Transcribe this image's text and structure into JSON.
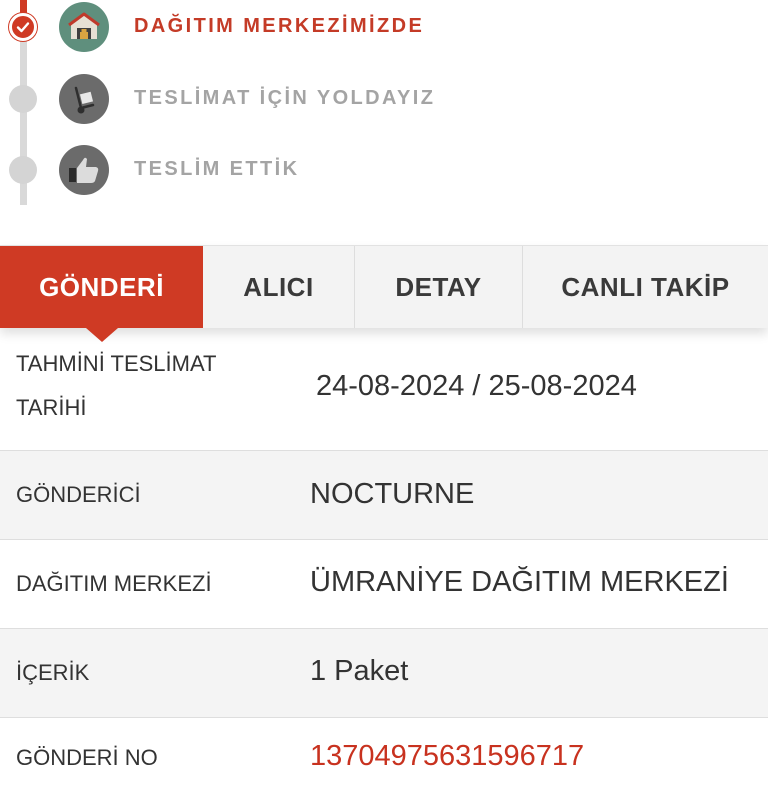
{
  "timeline": {
    "steps": [
      {
        "label": "DAĞITIM MERKEZİMİZDE",
        "status": "done",
        "icon": "warehouse-icon"
      },
      {
        "label": "TESLİMAT İÇİN YOLDAYIZ",
        "status": "pending",
        "icon": "hand-truck-icon"
      },
      {
        "label": "TESLİM ETTİK",
        "status": "pending",
        "icon": "thumbs-up-icon"
      }
    ]
  },
  "tabs": [
    {
      "label": "GÖNDERİ",
      "active": true
    },
    {
      "label": "ALICI",
      "active": false
    },
    {
      "label": "DETAY",
      "active": false
    },
    {
      "label": "CANLI TAKİP",
      "active": false
    }
  ],
  "details": {
    "estimated_delivery": {
      "label_line1": "TAHMİNİ TESLİMAT",
      "label_line2": "TARİHİ",
      "value": "24-08-2024 / 25-08-2024"
    },
    "sender": {
      "label": "GÖNDERİCİ",
      "value": "NOCTURNE"
    },
    "distribution_center": {
      "label": "DAĞITIM MERKEZİ",
      "value": "ÜMRANİYE DAĞITIM MERKEZİ"
    },
    "content": {
      "label": "İÇERİK",
      "value": "1 Paket"
    },
    "shipment_no": {
      "label": "GÖNDERİ NO",
      "value": "13704975631596717"
    }
  },
  "colors": {
    "accent": "#cf3a24",
    "muted": "#a4a4a4",
    "text": "#333333"
  }
}
